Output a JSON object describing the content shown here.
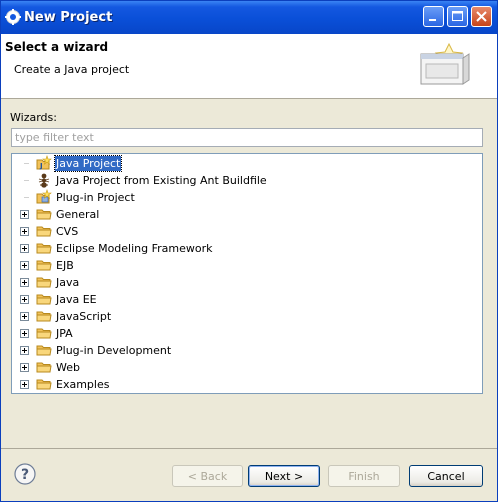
{
  "window": {
    "title": "New Project"
  },
  "header": {
    "title": "Select a wizard",
    "subtitle": "Create a Java project"
  },
  "wizards": {
    "label": "Wizards:",
    "filter_placeholder": "type filter text",
    "filter_value": "",
    "items": [
      {
        "label": "Java Project",
        "icon": "java-project-icon",
        "expandable": false,
        "selected": true
      },
      {
        "label": "Java Project from Existing Ant Buildfile",
        "icon": "ant-icon",
        "expandable": false,
        "selected": false
      },
      {
        "label": "Plug-in Project",
        "icon": "plugin-project-icon",
        "expandable": false,
        "selected": false
      },
      {
        "label": "General",
        "icon": "folder-icon",
        "expandable": true,
        "selected": false
      },
      {
        "label": "CVS",
        "icon": "folder-icon",
        "expandable": true,
        "selected": false
      },
      {
        "label": "Eclipse Modeling Framework",
        "icon": "folder-icon",
        "expandable": true,
        "selected": false
      },
      {
        "label": "EJB",
        "icon": "folder-icon",
        "expandable": true,
        "selected": false
      },
      {
        "label": "Java",
        "icon": "folder-icon",
        "expandable": true,
        "selected": false
      },
      {
        "label": "Java EE",
        "icon": "folder-icon",
        "expandable": true,
        "selected": false
      },
      {
        "label": "JavaScript",
        "icon": "folder-icon",
        "expandable": true,
        "selected": false
      },
      {
        "label": "JPA",
        "icon": "folder-icon",
        "expandable": true,
        "selected": false
      },
      {
        "label": "Plug-in Development",
        "icon": "folder-icon",
        "expandable": true,
        "selected": false
      },
      {
        "label": "Web",
        "icon": "folder-icon",
        "expandable": true,
        "selected": false
      },
      {
        "label": "Examples",
        "icon": "folder-icon",
        "expandable": true,
        "selected": false
      }
    ]
  },
  "buttons": {
    "back": {
      "label": "< Back",
      "enabled": false
    },
    "next": {
      "label": "Next >",
      "enabled": true
    },
    "finish": {
      "label": "Finish",
      "enabled": false
    },
    "cancel": {
      "label": "Cancel",
      "enabled": true
    }
  },
  "colors": {
    "titlebar": "#0a4fd8",
    "selection": "#316ac5",
    "dialog_bg": "#ece9d8",
    "folder": "#f2c25a"
  }
}
